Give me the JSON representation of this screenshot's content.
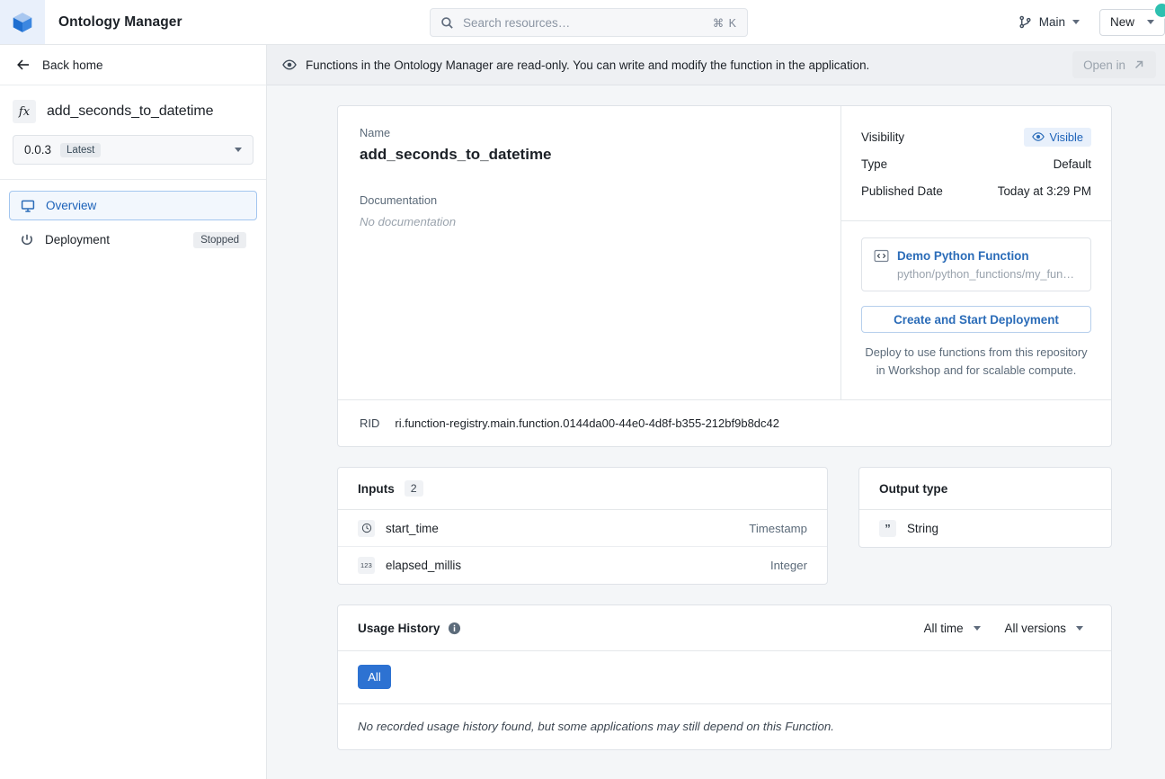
{
  "topbar": {
    "logo_icon": "cube-logo-icon",
    "app_title": "Ontology Manager",
    "search": {
      "placeholder": "Search resources…",
      "shortcut": "⌘ K",
      "icon": "search-icon"
    },
    "branch": {
      "label": "Main",
      "icon": "git-branch-icon"
    },
    "new_button": {
      "label": "New"
    },
    "accent": "#2d72d2",
    "avatar_color": "#2ec0b0"
  },
  "notice": {
    "icon": "eye-icon",
    "text": "Functions in the Ontology Manager are read-only. You can write and modify the function in the application.",
    "open_in_label": "Open in",
    "open_in_icon": "external-link-icon"
  },
  "sidebar": {
    "back_home": {
      "label": "Back home",
      "icon": "arrow-left-icon"
    },
    "function": {
      "icon": "fx-icon",
      "name": "add_seconds_to_datetime"
    },
    "version": {
      "value": "0.0.3",
      "tag": "Latest"
    },
    "nav": [
      {
        "label": "Overview",
        "icon": "monitor-icon",
        "active": true,
        "badge": ""
      },
      {
        "label": "Deployment",
        "icon": "power-icon",
        "active": false,
        "badge": "Stopped"
      }
    ]
  },
  "overview": {
    "name_label": "Name",
    "name_value": "add_seconds_to_datetime",
    "documentation_label": "Documentation",
    "documentation_value": "No documentation",
    "meta": [
      {
        "key": "Visibility",
        "value": "Visible",
        "badge": true,
        "icon": "eye-icon"
      },
      {
        "key": "Type",
        "value": "Default",
        "badge": false
      },
      {
        "key": "Published Date",
        "value": "Today at 3:29 PM",
        "badge": false
      }
    ],
    "repository": {
      "icon": "code-repo-icon",
      "name": "Demo Python Function",
      "path": "python/python_functions/my_fun…"
    },
    "deploy_button": "Create and Start Deployment",
    "deploy_hint_line1": "Deploy to use functions from this repository",
    "deploy_hint_line2": "in Workshop and for scalable compute.",
    "rid_label": "RID",
    "rid_value": "ri.function-registry.main.function.0144da00-44e0-4d8f-b355-212bf9b8dc42"
  },
  "inputs": {
    "title": "Inputs",
    "count": "2",
    "rows": [
      {
        "name": "start_time",
        "type": "Timestamp",
        "icon": "clock-icon"
      },
      {
        "name": "elapsed_millis",
        "type": "Integer",
        "icon": "number-123-icon"
      }
    ]
  },
  "output": {
    "title": "Output type",
    "rows": [
      {
        "name": "String",
        "icon": "quote-icon"
      }
    ]
  },
  "usage_history": {
    "title": "Usage History",
    "info_icon": "info-icon",
    "time_filter": "All time",
    "version_filter": "All versions",
    "active_pill": "All",
    "empty_text": "No recorded usage history found, but some applications may still depend on this Function."
  }
}
